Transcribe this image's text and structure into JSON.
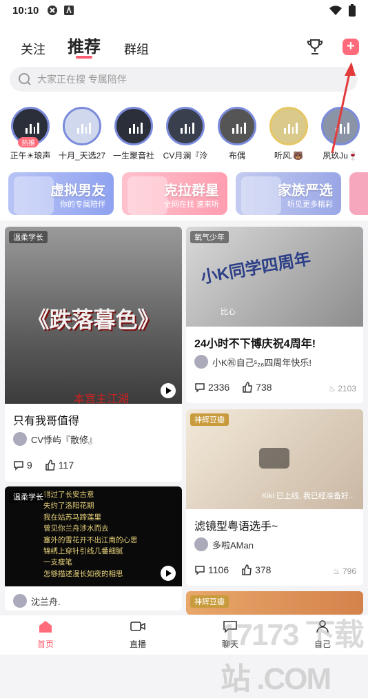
{
  "status": {
    "time": "10:10"
  },
  "header": {
    "tabs": [
      {
        "label": "关注"
      },
      {
        "label": "推荐"
      },
      {
        "label": "群组"
      }
    ],
    "plus_label": "+"
  },
  "search": {
    "placeholder": "大家正在搜 专属陪伴"
  },
  "live_users": [
    {
      "name": "正午☀琅声",
      "badge": "热推"
    },
    {
      "name": "十月_天选27"
    },
    {
      "name": "一生聚音社"
    },
    {
      "name": "CV月澜『泠"
    },
    {
      "name": "布偶"
    },
    {
      "name": "听风.🐻"
    },
    {
      "name": "夙玖Ju🍷"
    }
  ],
  "banners": [
    {
      "title": "虚拟男友",
      "subtitle": "你的专属陪伴",
      "color": "#8fa2f0"
    },
    {
      "title": "克拉群星",
      "subtitle": "全网在找 速来听",
      "color": "#ff9eb0"
    },
    {
      "title": "家族严选",
      "subtitle": "听见更多精彩",
      "color": "#9aa7e6"
    }
  ],
  "cards": [
    {
      "tag": "温柔学长",
      "image_text": "《跌落暮色》",
      "image_subtext": "本宫主江湖",
      "title": "只有我哥值得",
      "author": "CV悸屿『散修』",
      "comments": "9",
      "likes": "117"
    },
    {
      "tag": "氧气少年",
      "image_text": "小K同学四周年",
      "image_subtext": "比心",
      "title": "24小时不下博庆祝4周年!",
      "author": "小K㊗自己ˢ₂₆四周年快乐!",
      "comments": "2336",
      "likes": "738",
      "hot": "2103"
    },
    {
      "tag": "温柔学长",
      "lines": [
        "错过了长安古意",
        "失约了洛阳花期",
        "我在姑苏马蹄莲里",
        "曾见你兰舟涉水而去",
        "塞外的雪花开不出江南的心思",
        "锦绣上穿针引线几番细腻",
        "一支瘦笔",
        "怎够描述漫长如夜的相思"
      ],
      "author": "沈兰舟."
    },
    {
      "tag": "神辉豆瓣",
      "image_subtext": "Kiki 已上线, 我已经准备好...",
      "title": "滤镜型粤语选手~",
      "author": "多啦AMan",
      "comments": "1106",
      "likes": "378",
      "hot": "796"
    },
    {
      "tag": "神辉豆瓣"
    }
  ],
  "tabbar": [
    {
      "label": "首页"
    },
    {
      "label": "直播"
    },
    {
      "label": "聊天"
    },
    {
      "label": "自己"
    }
  ],
  "watermark": "17173 下载站 .COM",
  "colors": {
    "accent": "#ff5d6e",
    "ring": "#7b8bdc"
  }
}
